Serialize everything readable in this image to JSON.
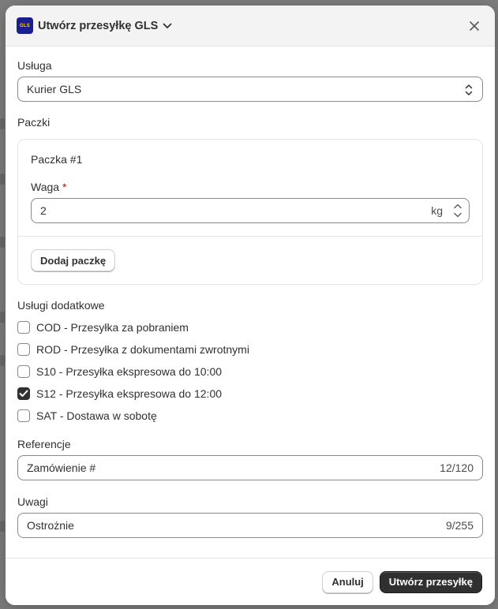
{
  "modal": {
    "title": "Utwórz przesyłkę GLS",
    "logo_text": "GLS"
  },
  "service": {
    "label": "Usługa",
    "value": "Kurier GLS"
  },
  "packages": {
    "label": "Paczki",
    "items": [
      {
        "title": "Paczka #1",
        "weight_label": "Waga",
        "required_mark": "*",
        "weight_value": "2",
        "unit": "kg"
      }
    ],
    "add_button": "Dodaj paczkę"
  },
  "additional": {
    "label": "Usługi dodatkowe",
    "options": [
      {
        "label": "COD - Przesyłka za pobraniem",
        "checked": false
      },
      {
        "label": "ROD - Przesyłka z dokumentami zwrotnymi",
        "checked": false
      },
      {
        "label": "S10 - Przesyłka ekspresowa do 10:00",
        "checked": false
      },
      {
        "label": "S12 - Przesyłka ekspresowa do 12:00",
        "checked": true
      },
      {
        "label": "SAT - Dostawa w sobotę",
        "checked": false
      }
    ]
  },
  "reference": {
    "label": "Referencje",
    "value": "Zamówienie #",
    "counter": "12/120"
  },
  "notes": {
    "label": "Uwagi",
    "value": "Ostrożnie",
    "counter": "9/255"
  },
  "footer": {
    "cancel": "Anuluj",
    "submit": "Utwórz przesyłkę"
  },
  "colors": {
    "primary": "#303030",
    "logo_bg": "#1b1e8f",
    "logo_fg": "#ffd200",
    "required": "#8e1f0b"
  }
}
